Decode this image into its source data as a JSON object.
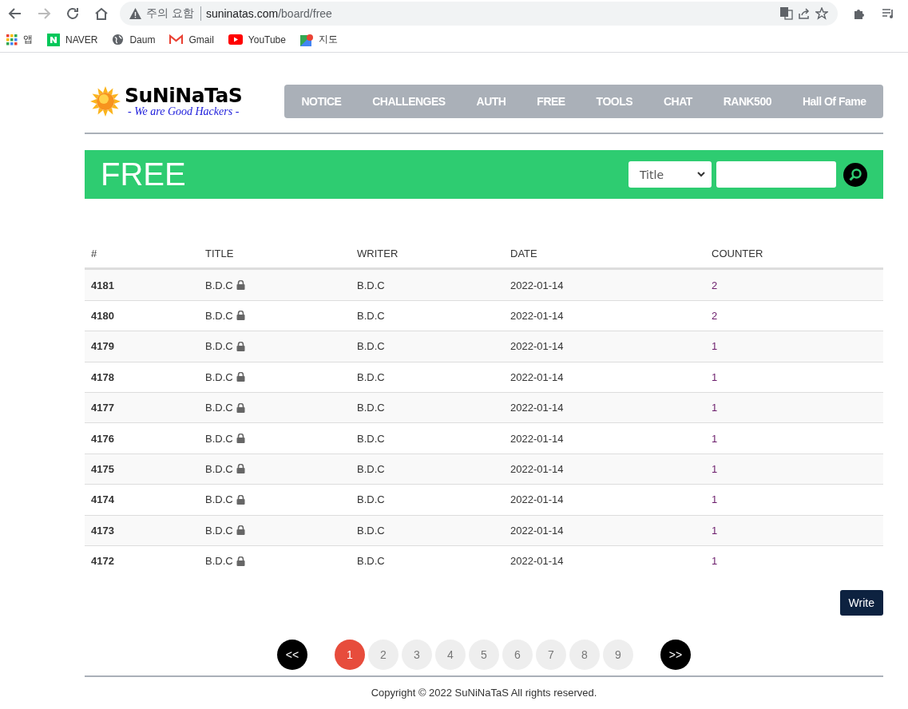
{
  "browser": {
    "security_label": "주의 요함",
    "url_host": "suninatas.com",
    "url_path": "/board/free",
    "bookmarks": [
      {
        "kind": "apps",
        "label": "앱"
      },
      {
        "kind": "naver",
        "label": "NAVER"
      },
      {
        "kind": "globe",
        "label": "Daum"
      },
      {
        "kind": "gmail",
        "label": "Gmail"
      },
      {
        "kind": "youtube",
        "label": "YouTube"
      },
      {
        "kind": "maps",
        "label": "지도"
      }
    ]
  },
  "logo": {
    "name": "SuNiNaTaS",
    "tagline": "- We are Good Hackers -"
  },
  "nav": [
    "NOTICE",
    "CHALLENGES",
    "AUTH",
    "FREE",
    "TOOLS",
    "CHAT",
    "RANK500",
    "Hall Of Fame"
  ],
  "board": {
    "title": "FREE",
    "search_type": "Title"
  },
  "table": {
    "columns": [
      "#",
      "TITLE",
      "WRITER",
      "DATE",
      "COUNTER"
    ],
    "rows": [
      {
        "no": "4181",
        "title": "B.D.C",
        "locked": true,
        "writer": "B.D.C",
        "date": "2022-01-14",
        "counter": "2"
      },
      {
        "no": "4180",
        "title": "B.D.C",
        "locked": true,
        "writer": "B.D.C",
        "date": "2022-01-14",
        "counter": "2"
      },
      {
        "no": "4179",
        "title": "B.D.C",
        "locked": true,
        "writer": "B.D.C",
        "date": "2022-01-14",
        "counter": "1"
      },
      {
        "no": "4178",
        "title": "B.D.C",
        "locked": true,
        "writer": "B.D.C",
        "date": "2022-01-14",
        "counter": "1"
      },
      {
        "no": "4177",
        "title": "B.D.C",
        "locked": true,
        "writer": "B.D.C",
        "date": "2022-01-14",
        "counter": "1"
      },
      {
        "no": "4176",
        "title": "B.D.C",
        "locked": true,
        "writer": "B.D.C",
        "date": "2022-01-14",
        "counter": "1"
      },
      {
        "no": "4175",
        "title": "B.D.C",
        "locked": true,
        "writer": "B.D.C",
        "date": "2022-01-14",
        "counter": "1"
      },
      {
        "no": "4174",
        "title": "B.D.C",
        "locked": true,
        "writer": "B.D.C",
        "date": "2022-01-14",
        "counter": "1"
      },
      {
        "no": "4173",
        "title": "B.D.C",
        "locked": true,
        "writer": "B.D.C",
        "date": "2022-01-14",
        "counter": "1"
      },
      {
        "no": "4172",
        "title": "B.D.C",
        "locked": true,
        "writer": "B.D.C",
        "date": "2022-01-14",
        "counter": "1"
      }
    ]
  },
  "write_button": "Write",
  "pagination": {
    "prev": "<<",
    "next": ">>",
    "pages": [
      {
        "label": "1",
        "selected": true
      },
      {
        "label": "2",
        "selected": false
      },
      {
        "label": "3",
        "selected": false
      },
      {
        "label": "4",
        "selected": false
      },
      {
        "label": "5",
        "selected": false
      },
      {
        "label": "6",
        "selected": false
      },
      {
        "label": "7",
        "selected": false
      },
      {
        "label": "8",
        "selected": false
      },
      {
        "label": "9",
        "selected": false
      }
    ]
  },
  "footer": "Copyright © 2022 SuNiNaTaS All rights reserved."
}
